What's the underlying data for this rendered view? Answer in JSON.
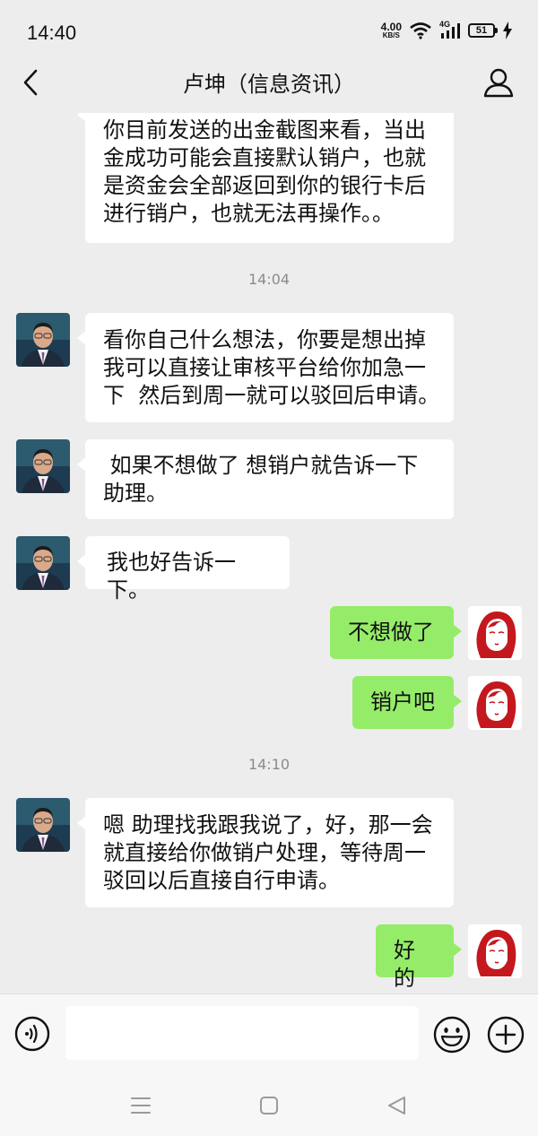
{
  "status_bar": {
    "time": "14:40",
    "net_speed_value": "4.00",
    "net_speed_unit": "KB/S",
    "network_type": "4G",
    "battery": "51",
    "icons": [
      "wifi-icon",
      "signal-icon",
      "battery-icon",
      "charging-icon"
    ]
  },
  "header": {
    "title": "卢坤（信息资讯）",
    "back_icon": "chevron-left-icon",
    "profile_icon": "person-icon"
  },
  "messages": [
    {
      "type": "text",
      "side": "in",
      "lines": [
        "你目前发送的出金截图来看，当出",
        "金成功可能会直接默认销户，也就",
        "是资金会全部返回到你的银行卡后",
        "进行销户，也就无法再操作。。"
      ]
    },
    {
      "type": "time",
      "text": "14:04"
    },
    {
      "type": "text",
      "side": "in",
      "lines": [
        "看你自己什么想法，你要是想出掉",
        "我可以直接让审核平台给你加急一",
        "下  然后到周一就可以驳回后申请。"
      ]
    },
    {
      "type": "text",
      "side": "in",
      "lines": [
        " 如果不想做了 想销户就告诉一下",
        "助理。"
      ]
    },
    {
      "type": "text",
      "side": "in",
      "lines": [
        "我也好告诉一下。"
      ]
    },
    {
      "type": "text",
      "side": "out",
      "lines": [
        "不想做了"
      ]
    },
    {
      "type": "text",
      "side": "out",
      "lines": [
        "销户吧"
      ]
    },
    {
      "type": "time",
      "text": "14:10"
    },
    {
      "type": "text",
      "side": "in",
      "lines": [
        "嗯 助理找我跟我说了，好，那一会",
        "就直接给你做销户处理，等待周一",
        "驳回以后直接自行申请。"
      ]
    },
    {
      "type": "text",
      "side": "out",
      "lines": [
        "好的"
      ]
    }
  ],
  "input_bar": {
    "voice_icon": "voice-icon",
    "text_value": "",
    "emoji_icon": "emoji-icon",
    "plus_icon": "plus-icon"
  },
  "nav_bar": {
    "icons": [
      "menu-icon",
      "home-icon",
      "back-triangle-icon"
    ]
  },
  "colors": {
    "background": "#ededed",
    "bubble_in": "#ffffff",
    "bubble_out": "#95ec69",
    "timestamp": "#8b8b8b"
  }
}
